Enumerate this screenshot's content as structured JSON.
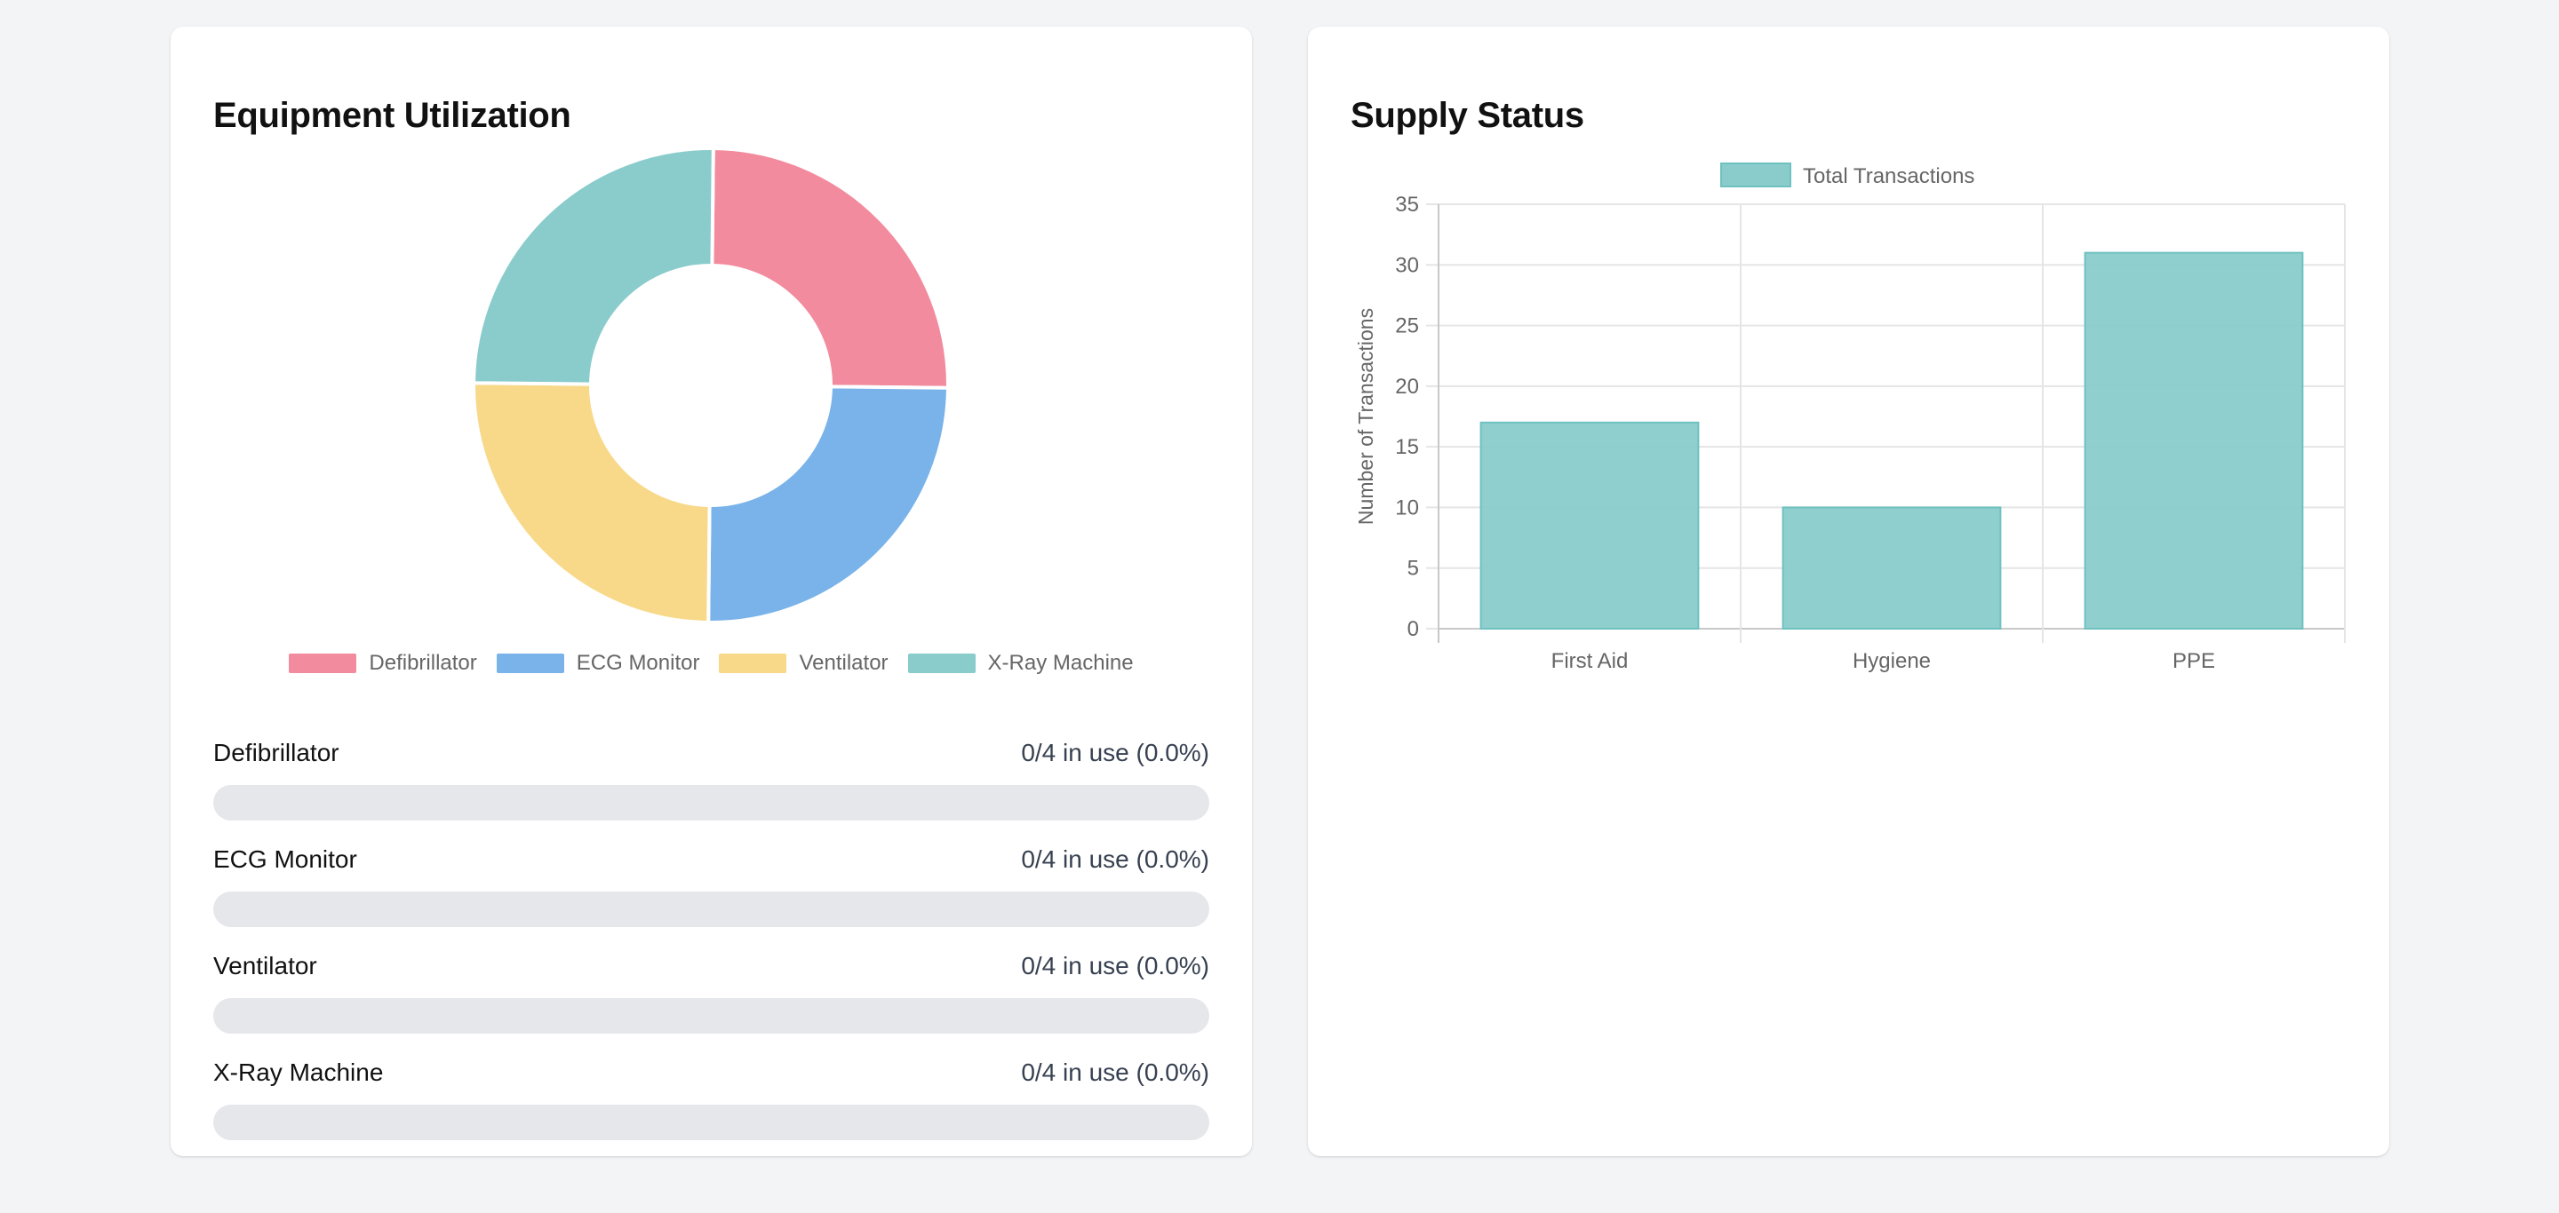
{
  "equipment_card": {
    "title": "Equipment Utilization",
    "chart_data": {
      "type": "pie",
      "donut": true,
      "categories": [
        "Defibrillator",
        "ECG Monitor",
        "Ventilator",
        "X-Ray Machine"
      ],
      "values": [
        4,
        4,
        4,
        4
      ],
      "colors": [
        "#f28b9e",
        "#79b3ea",
        "#f8d98a",
        "#89cccb"
      ],
      "legend_position": "bottom"
    },
    "items": [
      {
        "name": "Defibrillator",
        "stat": "0/4 in use (0.0%)",
        "fraction": 0
      },
      {
        "name": "ECG Monitor",
        "stat": "0/4 in use (0.0%)",
        "fraction": 0
      },
      {
        "name": "Ventilator",
        "stat": "0/4 in use (0.0%)",
        "fraction": 0
      },
      {
        "name": "X-Ray Machine",
        "stat": "0/4 in use (0.0%)",
        "fraction": 0
      }
    ]
  },
  "supply_card": {
    "title": "Supply Status",
    "chart_data": {
      "type": "bar",
      "categories": [
        "First Aid",
        "Hygiene",
        "PPE"
      ],
      "series": [
        {
          "name": "Total Transactions",
          "values": [
            17,
            10,
            31
          ],
          "color": "#89cccb"
        }
      ],
      "title": "",
      "xlabel": "",
      "ylabel": "Number of Transactions",
      "ylim": [
        0,
        35
      ],
      "yticks": [
        0,
        5,
        10,
        15,
        20,
        25,
        30,
        35
      ],
      "grid": true,
      "legend_position": "top"
    }
  }
}
